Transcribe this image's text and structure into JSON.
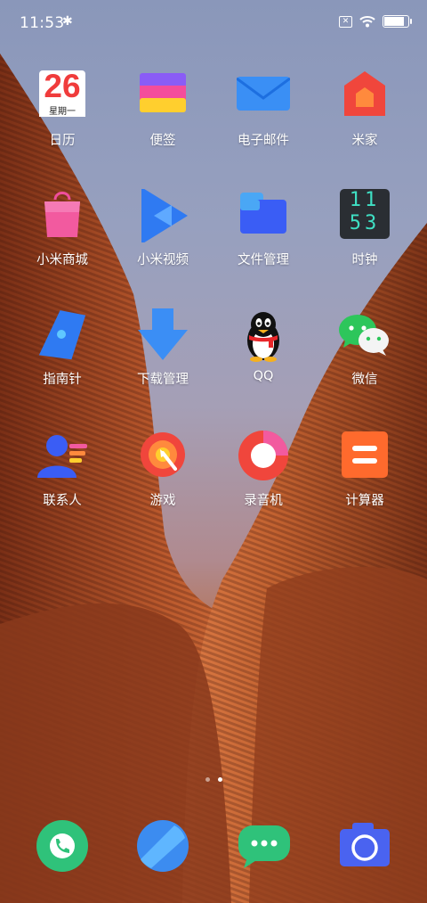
{
  "status_bar": {
    "time": "11:53",
    "bluetooth_icon": "bluetooth-icon",
    "sim_icon": "no-sim-icon",
    "wifi_icon": "wifi-icon",
    "battery_level": 0.92
  },
  "calendar_icon": {
    "date": "26",
    "weekday": "星期一"
  },
  "clock_icon": {
    "hour": "11",
    "minute": "53"
  },
  "apps": [
    {
      "label": "日历",
      "icon": "calendar-icon"
    },
    {
      "label": "便签",
      "icon": "notes-icon"
    },
    {
      "label": "电子邮件",
      "icon": "email-icon"
    },
    {
      "label": "米家",
      "icon": "mijia-home-icon"
    },
    {
      "label": "小米商城",
      "icon": "shopping-bag-icon"
    },
    {
      "label": "小米视频",
      "icon": "video-play-icon"
    },
    {
      "label": "文件管理",
      "icon": "folder-icon"
    },
    {
      "label": "时钟",
      "icon": "clock-icon"
    },
    {
      "label": "指南针",
      "icon": "compass-icon"
    },
    {
      "label": "下载管理",
      "icon": "download-arrow-icon"
    },
    {
      "label": "QQ",
      "icon": "qq-penguin-icon"
    },
    {
      "label": "微信",
      "icon": "wechat-icon"
    },
    {
      "label": "联系人",
      "icon": "contacts-icon"
    },
    {
      "label": "游戏",
      "icon": "game-target-icon"
    },
    {
      "label": "录音机",
      "icon": "recorder-icon"
    },
    {
      "label": "计算器",
      "icon": "calculator-icon"
    }
  ],
  "page_indicator": {
    "pages": 2,
    "current": 2
  },
  "dock": [
    {
      "icon": "phone-icon",
      "color": "#2fc27a"
    },
    {
      "icon": "browser-icon",
      "color": "#3c8cf0"
    },
    {
      "icon": "messages-icon",
      "color": "#2fc27a"
    },
    {
      "icon": "camera-icon",
      "color": "#4a63f0"
    }
  ]
}
